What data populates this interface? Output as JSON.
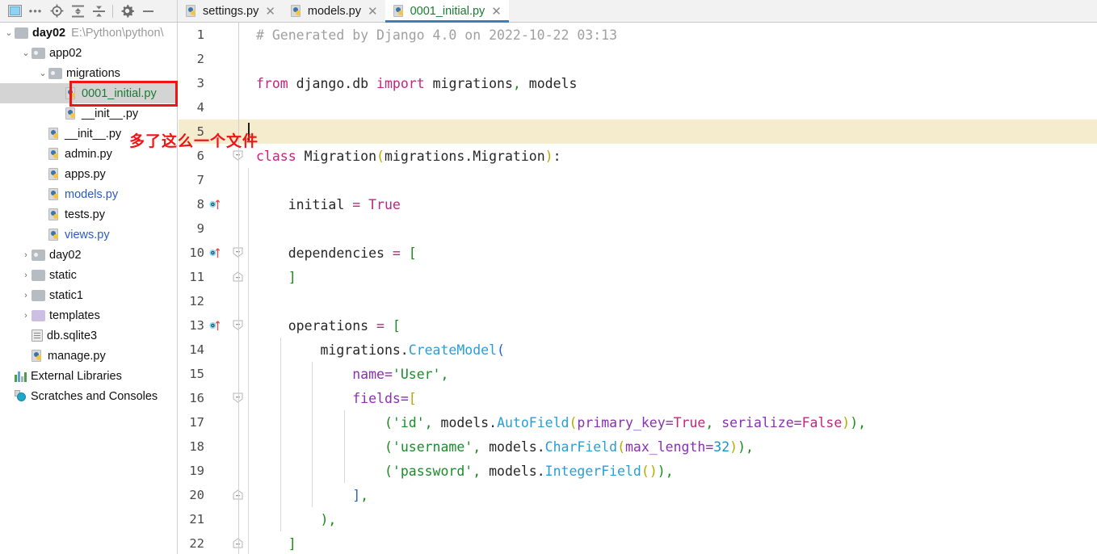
{
  "toolbar": {
    "icons": [
      {
        "name": "project-window-icon",
        "glyph": "window"
      },
      {
        "name": "more-options-icon",
        "glyph": "..."
      },
      {
        "name": "locate-file-icon",
        "glyph": "target"
      },
      {
        "name": "expand-all-icon",
        "glyph": "expand"
      },
      {
        "name": "collapse-all-icon",
        "glyph": "collapse"
      },
      {
        "name": "settings-gear-icon",
        "glyph": "gear"
      },
      {
        "name": "hide-panel-icon",
        "glyph": "minus"
      }
    ]
  },
  "tabs": [
    {
      "label": "settings.py",
      "active": false,
      "close": "✕"
    },
    {
      "label": "models.py",
      "active": false,
      "close": "✕"
    },
    {
      "label": "0001_initial.py",
      "active": true,
      "close": "✕"
    }
  ],
  "sidebar": {
    "items": [
      {
        "name": "project-root-day02",
        "label": "day02",
        "path": "E:\\Python\\python\\",
        "indent": 0,
        "arrow": "⌄",
        "icon": "folder",
        "style": "bold",
        "selected": false
      },
      {
        "name": "folder-app02",
        "label": "app02",
        "path": "",
        "indent": 1,
        "arrow": "⌄",
        "icon": "folder-mod",
        "style": "normal",
        "selected": false
      },
      {
        "name": "folder-migrations",
        "label": "migrations",
        "path": "",
        "indent": 2,
        "arrow": "⌄",
        "icon": "folder-mod",
        "style": "normal",
        "selected": false
      },
      {
        "name": "file-0001-initial-py",
        "label": "0001_initial.py",
        "path": "",
        "indent": 3,
        "arrow": "none",
        "icon": "python",
        "style": "green",
        "selected": true
      },
      {
        "name": "file-migrations-init-py",
        "label": "__init__.py",
        "path": "",
        "indent": 3,
        "arrow": "none",
        "icon": "python",
        "style": "normal",
        "selected": false
      },
      {
        "name": "file-app02-init-py",
        "label": "__init__.py",
        "path": "",
        "indent": 2,
        "arrow": "none",
        "icon": "python",
        "style": "normal",
        "selected": false
      },
      {
        "name": "file-admin-py",
        "label": "admin.py",
        "path": "",
        "indent": 2,
        "arrow": "none",
        "icon": "python",
        "style": "normal",
        "selected": false
      },
      {
        "name": "file-apps-py",
        "label": "apps.py",
        "path": "",
        "indent": 2,
        "arrow": "none",
        "icon": "python",
        "style": "normal",
        "selected": false
      },
      {
        "name": "file-models-py",
        "label": "models.py",
        "path": "",
        "indent": 2,
        "arrow": "none",
        "icon": "python",
        "style": "blue",
        "selected": false
      },
      {
        "name": "file-tests-py",
        "label": "tests.py",
        "path": "",
        "indent": 2,
        "arrow": "none",
        "icon": "python",
        "style": "normal",
        "selected": false
      },
      {
        "name": "file-views-py",
        "label": "views.py",
        "path": "",
        "indent": 2,
        "arrow": "none",
        "icon": "python",
        "style": "blue",
        "selected": false
      },
      {
        "name": "folder-day02",
        "label": "day02",
        "path": "",
        "indent": 1,
        "arrow": "›",
        "icon": "folder-mod",
        "style": "normal",
        "selected": false
      },
      {
        "name": "folder-static",
        "label": "static",
        "path": "",
        "indent": 1,
        "arrow": "›",
        "icon": "folder",
        "style": "normal",
        "selected": false
      },
      {
        "name": "folder-static1",
        "label": "static1",
        "path": "",
        "indent": 1,
        "arrow": "›",
        "icon": "folder",
        "style": "normal",
        "selected": false
      },
      {
        "name": "folder-templates",
        "label": "templates",
        "path": "",
        "indent": 1,
        "arrow": "›",
        "icon": "folder-purple",
        "style": "normal",
        "selected": false
      },
      {
        "name": "file-db-sqlite3",
        "label": "db.sqlite3",
        "path": "",
        "indent": 1,
        "arrow": "none",
        "icon": "sqlite",
        "style": "normal",
        "selected": false
      },
      {
        "name": "file-manage-py",
        "label": "manage.py",
        "path": "",
        "indent": 1,
        "arrow": "none",
        "icon": "python",
        "style": "normal",
        "selected": false
      },
      {
        "name": "node-external-libraries",
        "label": "External Libraries",
        "path": "",
        "indent": 0,
        "arrow": "none",
        "icon": "library",
        "style": "normal",
        "selected": false
      },
      {
        "name": "node-scratches-and-consoles",
        "label": "Scratches and Consoles",
        "path": "",
        "indent": 0,
        "arrow": "none",
        "icon": "scratch",
        "style": "normal",
        "selected": false
      }
    ]
  },
  "editor": {
    "caret_line": 5,
    "lines": [
      {
        "n": "1",
        "mark": "none",
        "fold": "none",
        "guides": 0,
        "tokens": [
          {
            "t": "# Generated by Django 4.0 on 2022-10-22 03:13",
            "c": "c-com"
          }
        ]
      },
      {
        "n": "2",
        "mark": "none",
        "fold": "none",
        "guides": 0,
        "tokens": []
      },
      {
        "n": "3",
        "mark": "none",
        "fold": "none",
        "guides": 0,
        "tokens": [
          {
            "t": "from",
            "c": "c-kw"
          },
          {
            "t": " django.db ",
            "c": "c-def"
          },
          {
            "t": "import",
            "c": "c-kw"
          },
          {
            "t": " migrations",
            "c": "c-def"
          },
          {
            "t": ",",
            "c": "c-comma"
          },
          {
            "t": " models",
            "c": "c-def"
          }
        ]
      },
      {
        "n": "4",
        "mark": "none",
        "fold": "none",
        "guides": 0,
        "tokens": []
      },
      {
        "n": "5",
        "mark": "none",
        "fold": "none",
        "guides": 0,
        "tokens": [],
        "current": true
      },
      {
        "n": "6",
        "mark": "none",
        "fold": "open",
        "guides": 0,
        "tokens": [
          {
            "t": "class",
            "c": "c-kw"
          },
          {
            "t": " Migration",
            "c": "c-def"
          },
          {
            "t": "(",
            "c": "c-br1"
          },
          {
            "t": "migrations.Migration",
            "c": "c-def"
          },
          {
            "t": ")",
            "c": "c-br1"
          },
          {
            "t": ":",
            "c": "c-def"
          }
        ]
      },
      {
        "n": "7",
        "mark": "none",
        "fold": "none",
        "guides": 1,
        "tokens": []
      },
      {
        "n": "8",
        "mark": "override",
        "fold": "none",
        "guides": 1,
        "tokens": [
          {
            "t": "    initial ",
            "c": "c-def"
          },
          {
            "t": "=",
            "c": "c-kw"
          },
          {
            "t": " ",
            "c": "c-def"
          },
          {
            "t": "True",
            "c": "c-kw"
          }
        ]
      },
      {
        "n": "9",
        "mark": "none",
        "fold": "none",
        "guides": 1,
        "tokens": []
      },
      {
        "n": "10",
        "mark": "override",
        "fold": "open",
        "guides": 1,
        "tokens": [
          {
            "t": "    dependencies ",
            "c": "c-def"
          },
          {
            "t": "=",
            "c": "c-kw"
          },
          {
            "t": " ",
            "c": "c-def"
          },
          {
            "t": "[",
            "c": "c-br2"
          }
        ]
      },
      {
        "n": "11",
        "mark": "none",
        "fold": "close",
        "guides": 1,
        "tokens": [
          {
            "t": "    ",
            "c": "c-def"
          },
          {
            "t": "]",
            "c": "c-br2"
          }
        ]
      },
      {
        "n": "12",
        "mark": "none",
        "fold": "none",
        "guides": 1,
        "tokens": []
      },
      {
        "n": "13",
        "mark": "override",
        "fold": "open",
        "guides": 1,
        "tokens": [
          {
            "t": "    operations ",
            "c": "c-def"
          },
          {
            "t": "=",
            "c": "c-kw"
          },
          {
            "t": " ",
            "c": "c-def"
          },
          {
            "t": "[",
            "c": "c-br2"
          }
        ]
      },
      {
        "n": "14",
        "mark": "none",
        "fold": "none",
        "guides": 2,
        "tokens": [
          {
            "t": "        migrations.",
            "c": "c-def"
          },
          {
            "t": "CreateModel",
            "c": "c-fn"
          },
          {
            "t": "(",
            "c": "c-br3"
          }
        ]
      },
      {
        "n": "15",
        "mark": "none",
        "fold": "none",
        "guides": 3,
        "tokens": [
          {
            "t": "            name",
            "c": "c-kwarg"
          },
          {
            "t": "=",
            "c": "c-kwarg"
          },
          {
            "t": "'User'",
            "c": "c-str"
          },
          {
            "t": ",",
            "c": "c-comma"
          }
        ]
      },
      {
        "n": "16",
        "mark": "none",
        "fold": "open",
        "guides": 3,
        "tokens": [
          {
            "t": "            fields",
            "c": "c-kwarg"
          },
          {
            "t": "=",
            "c": "c-kwarg"
          },
          {
            "t": "[",
            "c": "c-br1"
          }
        ]
      },
      {
        "n": "17",
        "mark": "none",
        "fold": "none",
        "guides": 4,
        "tokens": [
          {
            "t": "                (",
            "c": "c-br2"
          },
          {
            "t": "'id'",
            "c": "c-str"
          },
          {
            "t": ",",
            "c": "c-comma"
          },
          {
            "t": " models.",
            "c": "c-def"
          },
          {
            "t": "AutoField",
            "c": "c-fn"
          },
          {
            "t": "(",
            "c": "c-br1"
          },
          {
            "t": "primary_key",
            "c": "c-kwarg"
          },
          {
            "t": "=",
            "c": "c-kwarg"
          },
          {
            "t": "True",
            "c": "c-kw"
          },
          {
            "t": ",",
            "c": "c-comma"
          },
          {
            "t": " ",
            "c": "c-def"
          },
          {
            "t": "serialize",
            "c": "c-kwarg"
          },
          {
            "t": "=",
            "c": "c-kwarg"
          },
          {
            "t": "False",
            "c": "c-kw"
          },
          {
            "t": ")",
            "c": "c-br1"
          },
          {
            "t": ")",
            "c": "c-br2"
          },
          {
            "t": ",",
            "c": "c-comma"
          }
        ]
      },
      {
        "n": "18",
        "mark": "none",
        "fold": "none",
        "guides": 4,
        "tokens": [
          {
            "t": "                (",
            "c": "c-br2"
          },
          {
            "t": "'username'",
            "c": "c-str"
          },
          {
            "t": ",",
            "c": "c-comma"
          },
          {
            "t": " models.",
            "c": "c-def"
          },
          {
            "t": "CharField",
            "c": "c-fn"
          },
          {
            "t": "(",
            "c": "c-br1"
          },
          {
            "t": "max_length",
            "c": "c-kwarg"
          },
          {
            "t": "=",
            "c": "c-kwarg"
          },
          {
            "t": "32",
            "c": "c-num"
          },
          {
            "t": ")",
            "c": "c-br1"
          },
          {
            "t": ")",
            "c": "c-br2"
          },
          {
            "t": ",",
            "c": "c-comma"
          }
        ]
      },
      {
        "n": "19",
        "mark": "none",
        "fold": "none",
        "guides": 4,
        "tokens": [
          {
            "t": "                (",
            "c": "c-br2"
          },
          {
            "t": "'password'",
            "c": "c-str"
          },
          {
            "t": ",",
            "c": "c-comma"
          },
          {
            "t": " models.",
            "c": "c-def"
          },
          {
            "t": "IntegerField",
            "c": "c-fn"
          },
          {
            "t": "(",
            "c": "c-br1"
          },
          {
            "t": ")",
            "c": "c-br1"
          },
          {
            "t": ")",
            "c": "c-br2"
          },
          {
            "t": ",",
            "c": "c-comma"
          }
        ]
      },
      {
        "n": "20",
        "mark": "none",
        "fold": "close",
        "guides": 3,
        "tokens": [
          {
            "t": "            ",
            "c": "c-def"
          },
          {
            "t": "]",
            "c": "c-br3"
          },
          {
            "t": ",",
            "c": "c-comma"
          }
        ]
      },
      {
        "n": "21",
        "mark": "none",
        "fold": "none",
        "guides": 2,
        "tokens": [
          {
            "t": "        ",
            "c": "c-def"
          },
          {
            "t": ")",
            "c": "c-br2"
          },
          {
            "t": ",",
            "c": "c-comma"
          }
        ]
      },
      {
        "n": "22",
        "mark": "none",
        "fold": "close",
        "guides": 1,
        "tokens": [
          {
            "t": "    ",
            "c": "c-def"
          },
          {
            "t": "]",
            "c": "c-br2"
          }
        ]
      }
    ]
  },
  "annotations": {
    "highlight_rect_target": "0001_initial.py",
    "note_text": "多了这么一个文件",
    "note_color": "#f01414"
  }
}
